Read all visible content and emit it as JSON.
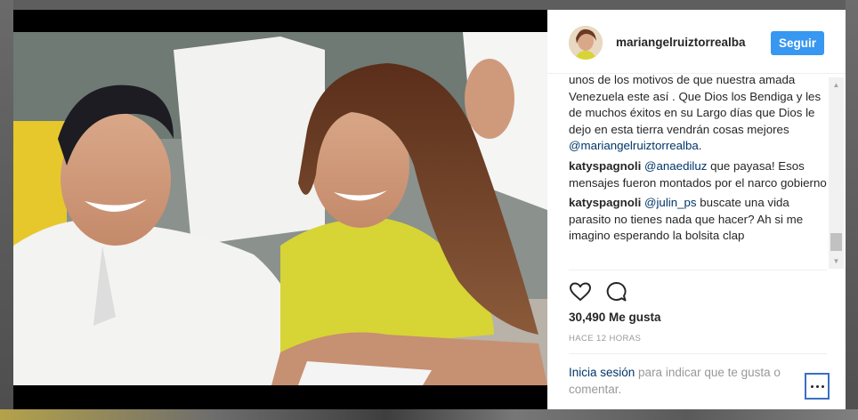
{
  "post": {
    "username": "mariangelruiztorrealba",
    "follow_label": "Seguir",
    "comments": [
      {
        "text": "unos de los motivos de que nuestra amada Venezuela este así . Que Dios los Bendiga y les de muchos éxitos en su Largo días que Dios le dejo en esta tierra vendrán cosas mejores ",
        "mention": "@mariangelruiztorrealba",
        "after": "."
      },
      {
        "user": "katyspagnoli",
        "mention": "@anaediluz",
        "text": " que payasa! Esos mensajes fueron montados por el narco gobierno"
      },
      {
        "user": "katyspagnoli",
        "mention": "@julin_ps",
        "text": " buscate una vida parasito no tienes nada que hacer? Ah si me imagino esperando la bolsita clap"
      }
    ],
    "likes": "30,490 Me gusta",
    "time": "HACE 12 HORAS",
    "login_link": "Inicia sesión",
    "login_text": " para indicar que te gusta o comentar."
  },
  "icons": {
    "like": "heart-outline-icon",
    "comment": "speech-bubble-icon",
    "more": "ellipsis-icon"
  },
  "colors": {
    "follow_button": "#3897f0",
    "link": "#003569",
    "text": "#262626",
    "muted": "#999999"
  }
}
